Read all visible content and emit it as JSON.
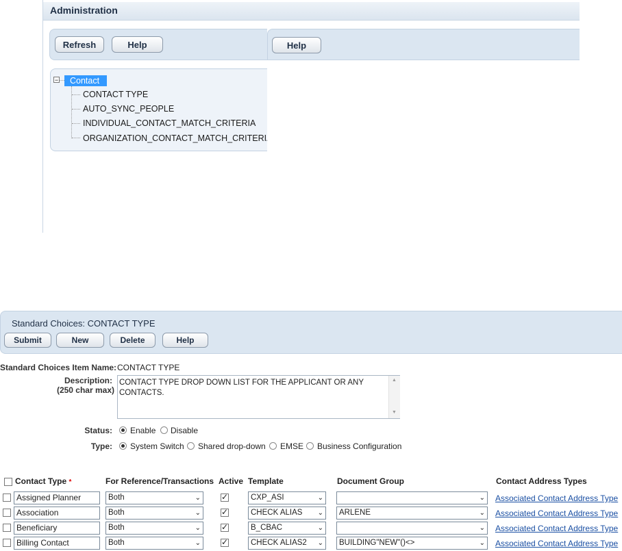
{
  "administration": {
    "title": "Administration",
    "left_toolbar": {
      "refresh_label": "Refresh",
      "help_label": "Help"
    },
    "right_toolbar": {
      "help_label": "Help"
    },
    "tree": {
      "root_label": "Contact",
      "toggle_symbol": "−",
      "children": [
        "CONTACT TYPE",
        "AUTO_SYNC_PEOPLE",
        "INDIVIDUAL_CONTACT_MATCH_CRITERIA",
        "ORGANIZATION_CONTACT_MATCH_CRITERIA"
      ]
    }
  },
  "standard_choices": {
    "title": "Standard Choices: CONTACT TYPE",
    "buttons": {
      "submit": "Submit",
      "new": "New",
      "delete": "Delete",
      "help": "Help"
    },
    "item_name_label": "Standard Choices Item Name:",
    "item_name_value": "CONTACT TYPE",
    "description_label": "Description:",
    "description_hint": "(250 char max)",
    "description_value": "CONTACT TYPE DROP DOWN LIST FOR THE APPLICANT OR ANY CONTACTS.",
    "status_label": "Status:",
    "status_options": [
      "Enable",
      "Disable"
    ],
    "status_selected": "Enable",
    "type_label": "Type:",
    "type_options": [
      "System Switch",
      "Shared drop-down",
      "EMSE",
      "Business Configuration"
    ],
    "type_selected": "System Switch"
  },
  "table": {
    "headers": {
      "contact_type": "Contact Type",
      "required_mark": "*",
      "for_reference": "For Reference/Transactions",
      "active": "Active",
      "template": "Template",
      "document_group": "Document Group",
      "contact_address_types": "Contact Address Types"
    },
    "rows": [
      {
        "contact_type": "Assigned Planner",
        "for_reference": "Both",
        "active": true,
        "template": "CXP_ASI",
        "document_group": "",
        "link": "Associated Contact Address Type"
      },
      {
        "contact_type": "Association",
        "for_reference": "Both",
        "active": true,
        "template": "CHECK ALIAS",
        "document_group": "ARLENE",
        "link": "Associated Contact Address Type"
      },
      {
        "contact_type": "Beneficiary",
        "for_reference": "Both",
        "active": true,
        "template": "B_CBAC",
        "document_group": "",
        "link": "Associated Contact Address Type"
      },
      {
        "contact_type": "Billing Contact",
        "for_reference": "Both",
        "active": true,
        "template": "CHECK ALIAS2",
        "document_group": "BUILDING\"NEW\"()<>",
        "link": "Associated Contact Address Type"
      }
    ]
  },
  "icons": {
    "checkmark": "✓",
    "chevron_down": "⌄",
    "scroll_up": "▲",
    "scroll_down": "▼"
  }
}
